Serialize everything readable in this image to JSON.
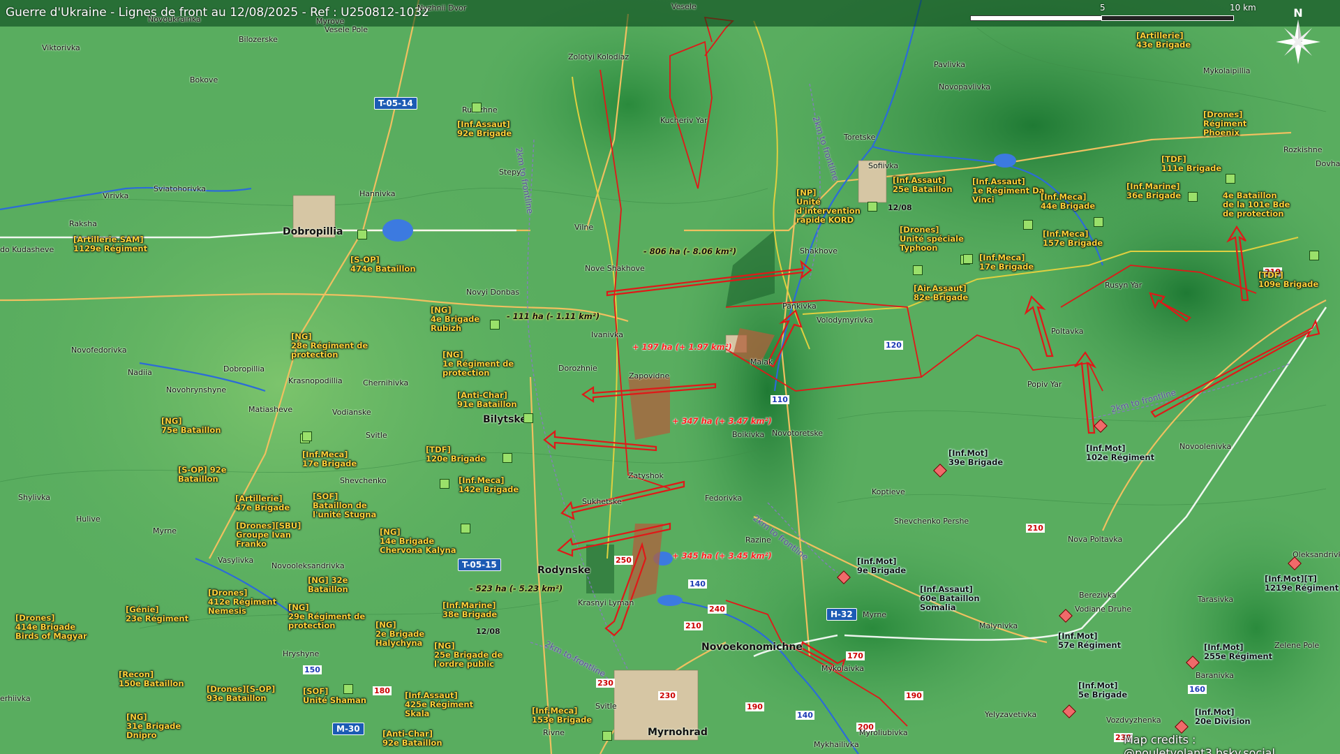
{
  "title": "Guerre d'Ukraine - Lignes de front au 12/08/2025 - Ref : U250812-1032",
  "scale": {
    "mid": "5",
    "end": "10 km"
  },
  "compass": "N",
  "credits": "Map credits : @pouletvolant3.bsky.social",
  "colors": {
    "ukraine_units": "#ffd23a",
    "front_arrow": "#e01818",
    "zone_fill": "#b0603c",
    "terrain": "#4ea65a"
  },
  "roads": [
    "T-05-14",
    "T-05-15",
    "H-32",
    "M-30"
  ],
  "front_labels": [
    "2km to frontline",
    "2km to frontline",
    "2km to frontline",
    "2km to frontline",
    "2km to frontline"
  ],
  "route_numbers": [
    "210",
    "120",
    "110",
    "250",
    "140",
    "240",
    "210",
    "230",
    "230",
    "190",
    "140",
    "210",
    "200",
    "160",
    "170",
    "190",
    "150",
    "180",
    "230"
  ],
  "date_tags": [
    "12/08",
    "12/08"
  ],
  "towns": [
    "Dobropillia",
    "Bilytske",
    "Rodynske",
    "Novoekonomichne",
    "Myrnohrad",
    "Viktorivka",
    "Bilozerske",
    "Bokove",
    "Virivka",
    "Sviatohorivka",
    "Hannivka",
    "Raksha",
    "do Kudasheve",
    "Novyi Donbas",
    "Novofedorivka",
    "Nadiia",
    "Dobropillia",
    "Krasnopodillia",
    "Chernihivka",
    "Novohrynshyne",
    "Matiasheve",
    "Vodianske",
    "Svitle",
    "Shevchenko",
    "Shylivka",
    "Hulive",
    "Myrne",
    "Vasylivka",
    "Novooleksandrivka",
    "Hryshyne",
    "Rubizhne",
    "Stepy",
    "Vilne",
    "Nove Shakhove",
    "Ivanivka",
    "Dorozhnie",
    "Zapovidne",
    "Zatyshok",
    "Sukhetske",
    "Fedorivka",
    "Krasnyi Lyman",
    "Razine",
    "Novotoretske",
    "Boikivka",
    "Maiak",
    "Pankivka",
    "Volodymyrivka",
    "Shakhove",
    "Toretske",
    "Sofiivka",
    "Pavlivka",
    "Novopavlivka",
    "Mykolaipillia",
    "Rozkishne",
    "Rusyn Yar",
    "Poltavka",
    "Popiv Yar",
    "Koptieve",
    "Shevchenko Pershe",
    "Nova Poltavka",
    "Novoolenivka",
    "Berezivka",
    "Vodiane Druhe",
    "Tarasivka",
    "Zelene Pole",
    "Baranivka",
    "Vozdvyzhenka",
    "Yelyzavetivka",
    "Mykhailivka",
    "Myroliubivka",
    "Mykolaivka",
    "Malynivka",
    "Myrne",
    "Rivne",
    "Svitle",
    "Kucheriv Yar",
    "Zolotyi Kolodiaz",
    "Vesele",
    "Myrove",
    "Vesele Pole",
    "Novoukrainka",
    "Oleksandrivka",
    "Dovha",
    "Nyzhnii Dvor",
    "erhiivka"
  ],
  "units_ukr": [
    [
      "[Inf.Assaut]",
      "92e Brigade"
    ],
    [
      "[Artillerie.SAM]",
      "1129e Régiment"
    ],
    [
      "[S-OP]",
      "474e Bataillon"
    ],
    [
      "[NG]",
      "4e Brigade",
      "Rubizh"
    ],
    [
      "[NG]",
      "28e Régiment de",
      "protection"
    ],
    [
      "[NG]",
      "1e Régiment de",
      "protection"
    ],
    [
      "[Anti-Char]",
      "91e Bataillon"
    ],
    [
      "[NG]",
      "75e Bataillon"
    ],
    [
      "[Inf.Meca]",
      "17e Brigade"
    ],
    [
      "[TDF]",
      "120e Brigade"
    ],
    [
      "[Inf.Meca]",
      "142e Brigade"
    ],
    [
      "[S-OP] 92e",
      "Bataillon"
    ],
    [
      "[Artillerie]",
      "47e Brigade"
    ],
    [
      "[SOF]",
      "Bataillon de",
      "l'unité Stugna"
    ],
    [
      "[Drones][SBU]",
      "Groupe Ivan",
      "Franko"
    ],
    [
      "[NG]",
      "14e Brigade",
      "Chervona Kalyna"
    ],
    [
      "[NG] 32e",
      "Bataillon"
    ],
    [
      "[Drones]",
      "412e Régiment",
      "Nemesis"
    ],
    [
      "[Génie]",
      "23e Régiment"
    ],
    [
      "[NG]",
      "29e Régiment de",
      "protection"
    ],
    [
      "[Inf.Marine]",
      "38e Brigade"
    ],
    [
      "[NG]",
      "2e Brigade",
      "Halychyna"
    ],
    [
      "[Drones]",
      "414e Brigade",
      "Birds of Magyar"
    ],
    [
      "[NG]",
      "25e Brigade de",
      "l'ordre public"
    ],
    [
      "[Recon]",
      "150e Bataillon"
    ],
    [
      "[Drones][S-OP]",
      "93e Bataillon"
    ],
    [
      "[SOF]",
      "Unité Shaman"
    ],
    [
      "[Inf.Assaut]",
      "425e Régiment",
      "Skala"
    ],
    [
      "[NG]",
      "31e Brigade",
      "Dnipro"
    ],
    [
      "[Inf.Meca]",
      "153e Brigade"
    ],
    [
      "[Anti-Char]",
      "92e Bataillon"
    ],
    [
      "[NP]",
      "Unité",
      "d'intervention",
      "rapide KORD"
    ],
    [
      "[Inf.Assaut]",
      "25e Bataillon"
    ],
    [
      "[Inf.Assaut]",
      "1e Régiment Da",
      "Vinci"
    ],
    [
      "[Inf.Meca]",
      "44e Brigade"
    ],
    [
      "[Inf.Marine]",
      "36e Brigade"
    ],
    [
      "[TDF]",
      "111e Brigade"
    ],
    [
      "4e Bataillon",
      "de la 101e Bde",
      "de protection"
    ],
    [
      "[Drones]",
      "Unité spéciale",
      "Typhoon"
    ],
    [
      "[Inf.Meca]",
      "157e Brigade"
    ],
    [
      "[Inf.Meca]",
      "17e Brigade"
    ],
    [
      "[Air.Assaut]",
      "82e Brigade"
    ],
    [
      "[TDF]",
      "109e Brigade"
    ],
    [
      "[Artillerie]",
      "43e Brigade"
    ],
    [
      "[Drones]",
      "Régiment",
      "Phoenix"
    ]
  ],
  "units_rus": [
    [
      "[Inf.Mot]",
      "39e Brigade"
    ],
    [
      "[Inf.Mot]",
      "102e Régiment"
    ],
    [
      "[Inf.Mot]",
      "9e Brigade"
    ],
    [
      "[Inf.Assaut]",
      "60e Bataillon",
      "Somalia"
    ],
    [
      "[Inf.Mot]",
      "57e Régiment"
    ],
    [
      "[Inf.Mot]",
      "5e Brigade"
    ],
    [
      "[Inf.Mot]",
      "255e Régiment"
    ],
    [
      "[Inf.Mot]",
      "20e Division"
    ],
    [
      "[Inf.Mot][T]",
      "1219e Régiment"
    ]
  ],
  "gains": [
    "- 806 ha (- 8.06 km²)",
    "- 111 ha (- 1.11 km²)",
    "+ 197 ha (+ 1.97 km²)",
    "+ 347 ha (+ 3.47 km²)",
    "+ 345 ha (+ 3.45 km²)",
    "- 523 ha (- 5.23 km²)"
  ]
}
